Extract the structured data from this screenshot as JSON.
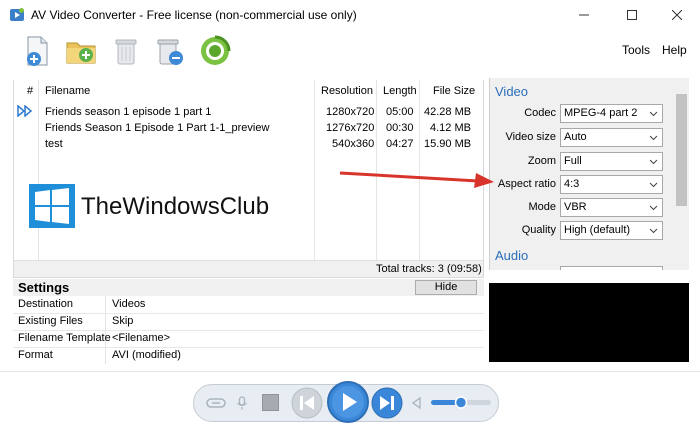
{
  "window": {
    "title": "AV Video Converter - Free license (non-commercial use only)"
  },
  "menu": {
    "tools": "Tools",
    "help": "Help"
  },
  "filelist": {
    "headers": {
      "num": "#",
      "filename": "Filename",
      "resolution": "Resolution",
      "length": "Length",
      "filesize": "File Size"
    },
    "rows": [
      {
        "filename": "Friends season 1 episode 1 part 1",
        "resolution": "1280x720",
        "length": "05:00",
        "size": "42.28 MB"
      },
      {
        "filename": "Friends Season 1 Episode 1 Part 1-1_preview",
        "resolution": "1276x720",
        "length": "00:30",
        "size": "4.12 MB"
      },
      {
        "filename": "test",
        "resolution": "540x360",
        "length": "04:27",
        "size": "15.90 MB"
      }
    ],
    "total": "Total tracks: 3 (09:58)"
  },
  "watermark": {
    "text": "TheWindowsClub"
  },
  "settings": {
    "title": "Settings",
    "hide": "Hide",
    "rows": [
      {
        "label": "Destination",
        "value": "Videos"
      },
      {
        "label": "Existing Files",
        "value": "Skip"
      },
      {
        "label": "Filename Template",
        "value": "<Filename>"
      },
      {
        "label": "Format",
        "value": "AVI (modified)"
      }
    ]
  },
  "video": {
    "title": "Video",
    "fields": [
      {
        "label": "Codec",
        "value": "MPEG-4 part 2"
      },
      {
        "label": "Video size",
        "value": "Auto"
      },
      {
        "label": "Zoom",
        "value": "Full"
      },
      {
        "label": "Aspect ratio",
        "value": "4:3"
      },
      {
        "label": "Mode",
        "value": "VBR"
      },
      {
        "label": "Quality",
        "value": "High (default)"
      }
    ]
  },
  "audio": {
    "title": "Audio"
  },
  "player": {
    "volume": 0.5
  },
  "colors": {
    "accent": "#2a6ebb",
    "arrow": "#d9342b",
    "play": "#3a86d8"
  }
}
